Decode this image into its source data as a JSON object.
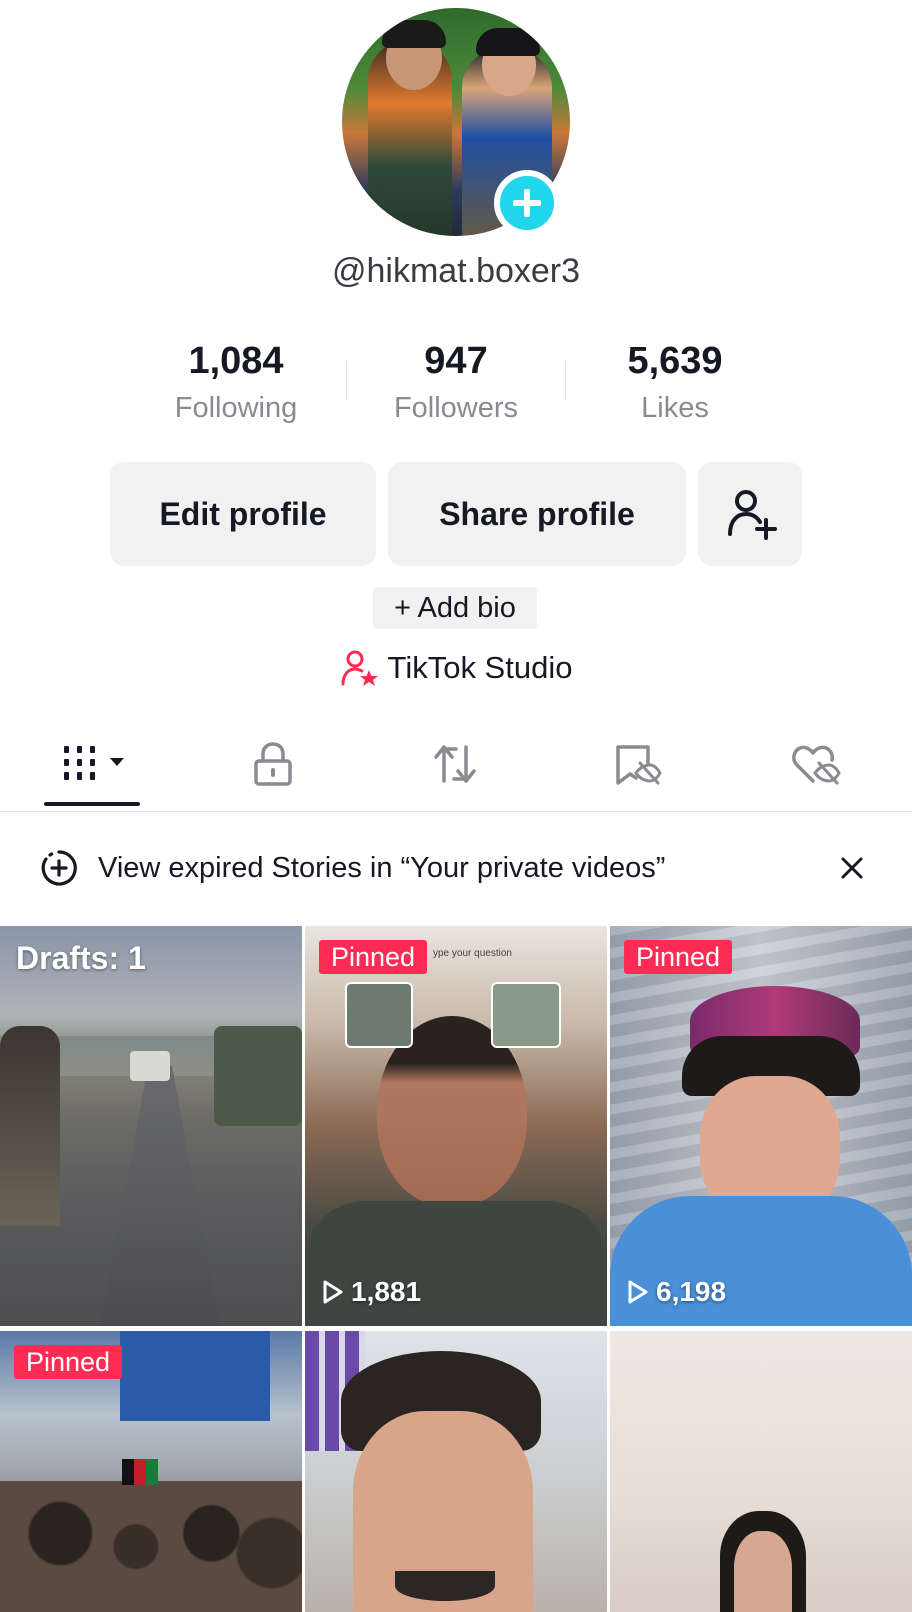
{
  "profile": {
    "username": "@hikmat.boxer3",
    "stats": [
      {
        "value": "1,084",
        "label": "Following"
      },
      {
        "value": "947",
        "label": "Followers"
      },
      {
        "value": "5,639",
        "label": "Likes"
      }
    ],
    "buttons": {
      "edit": "Edit profile",
      "share": "Share profile"
    },
    "add_bio": "+ Add bio",
    "studio": "TikTok Studio"
  },
  "tabs": [
    {
      "icon": "grid-icon"
    },
    {
      "icon": "lock-icon"
    },
    {
      "icon": "repost-icon"
    },
    {
      "icon": "bookmark-hidden-icon"
    },
    {
      "icon": "heart-hidden-icon"
    }
  ],
  "banner": {
    "text": "View expired Stories in “Your private videos”"
  },
  "grid": {
    "drafts_label": "Drafts: 1",
    "pinned_label": "Pinned",
    "video2_views": "1,881",
    "video3_views": "6,198",
    "video2_overlay": "ype your question"
  },
  "colors": {
    "accent_red": "#fe2c55",
    "accent_cyan": "#20d5ec",
    "text_primary": "#161823",
    "text_secondary": "#8a8b91",
    "button_bg": "#f1f1f2"
  }
}
